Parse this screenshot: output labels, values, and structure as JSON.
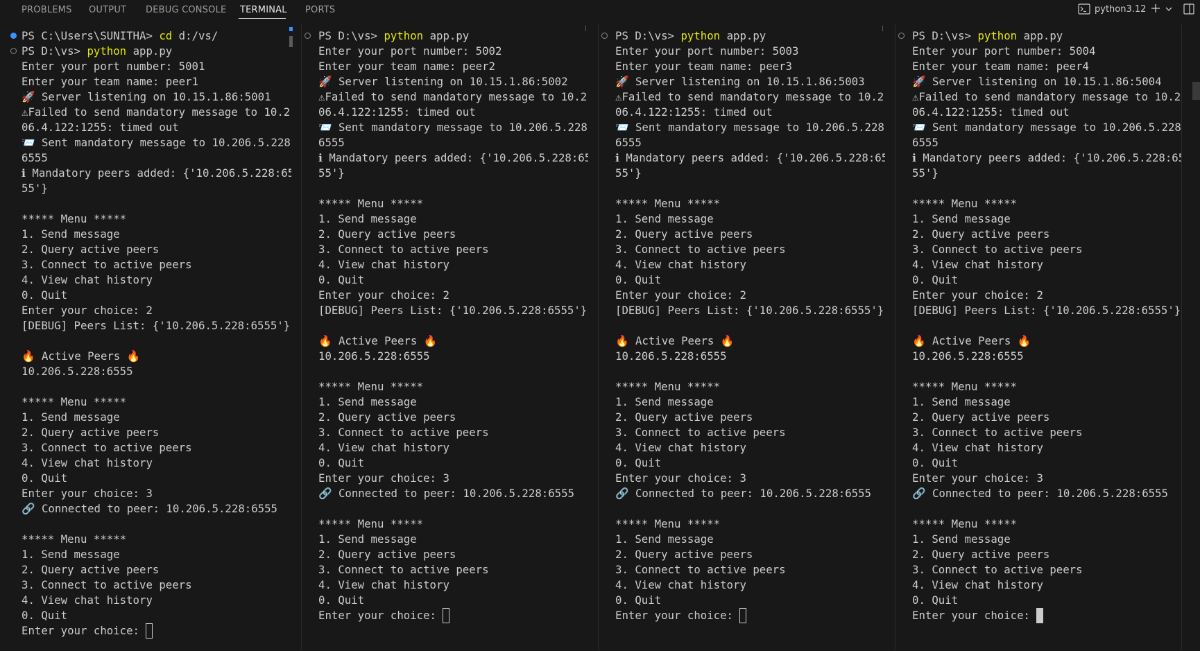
{
  "tabs": [
    {
      "label": "PROBLEMS",
      "active": false
    },
    {
      "label": "OUTPUT",
      "active": false
    },
    {
      "label": "DEBUG CONSOLE",
      "active": false
    },
    {
      "label": "TERMINAL",
      "active": true
    },
    {
      "label": "PORTS",
      "active": false
    }
  ],
  "toolbar": {
    "terminal_name": "python3.12",
    "icons": [
      "terminal-icon",
      "plus-icon",
      "chevron-down-icon",
      "split-layout-icon"
    ]
  },
  "colors": {
    "background": "#181818",
    "text": "#cccccc",
    "command": "#e5e510",
    "decoration_active": "#3794ff",
    "decoration_inactive": "#8a8a8a"
  },
  "terminals": [
    {
      "cursor": "hollow",
      "lines": [
        {
          "deco": "filled",
          "prompt": "PS C:\\Users\\SUNITHA> ",
          "cmd": "cd",
          "rest": " d:/vs/"
        },
        {
          "deco": "hollow",
          "prompt": "PS D:\\vs> ",
          "cmd": "python",
          "rest": " app.py"
        },
        {
          "text": "Enter your port number: 5001"
        },
        {
          "text": "Enter your team name: peer1"
        },
        {
          "text": "🚀 Server listening on 10.15.1.86:5001"
        },
        {
          "text": "⚠Failed to send mandatory message to 10.2"
        },
        {
          "text": "06.4.122:1255: timed out"
        },
        {
          "text": "📨 Sent mandatory message to 10.206.5.228:"
        },
        {
          "text": "6555"
        },
        {
          "text": "ℹ Mandatory peers added: {'10.206.5.228:65"
        },
        {
          "text": "55'}"
        },
        {
          "text": ""
        },
        {
          "text": "***** Menu *****"
        },
        {
          "text": "1. Send message"
        },
        {
          "text": "2. Query active peers"
        },
        {
          "text": "3. Connect to active peers"
        },
        {
          "text": "4. View chat history"
        },
        {
          "text": "0. Quit"
        },
        {
          "text": "Enter your choice: 2"
        },
        {
          "text": "[DEBUG] Peers List: {'10.206.5.228:6555'}"
        },
        {
          "text": ""
        },
        {
          "text": "🔥 Active Peers 🔥"
        },
        {
          "text": "10.206.5.228:6555"
        },
        {
          "text": ""
        },
        {
          "text": "***** Menu *****"
        },
        {
          "text": "1. Send message"
        },
        {
          "text": "2. Query active peers"
        },
        {
          "text": "3. Connect to active peers"
        },
        {
          "text": "4. View chat history"
        },
        {
          "text": "0. Quit"
        },
        {
          "text": "Enter your choice: 3"
        },
        {
          "text": "🔗 Connected to peer: 10.206.5.228:6555"
        },
        {
          "text": ""
        },
        {
          "text": "***** Menu *****"
        },
        {
          "text": "1. Send message"
        },
        {
          "text": "2. Query active peers"
        },
        {
          "text": "3. Connect to active peers"
        },
        {
          "text": "4. View chat history"
        },
        {
          "text": "0. Quit"
        },
        {
          "text": "Enter your choice: ",
          "cursor": true
        }
      ]
    },
    {
      "cursor": "hollow",
      "lines": [
        {
          "deco": "hollow",
          "prompt": "PS D:\\vs> ",
          "cmd": "python",
          "rest": " app.py"
        },
        {
          "text": "Enter your port number: 5002"
        },
        {
          "text": "Enter your team name: peer2"
        },
        {
          "text": "🚀 Server listening on 10.15.1.86:5002"
        },
        {
          "text": "⚠Failed to send mandatory message to 10.2"
        },
        {
          "text": "06.4.122:1255: timed out"
        },
        {
          "text": "📨 Sent mandatory message to 10.206.5.228:"
        },
        {
          "text": "6555"
        },
        {
          "text": "ℹ Mandatory peers added: {'10.206.5.228:65"
        },
        {
          "text": "55'}"
        },
        {
          "text": ""
        },
        {
          "text": "***** Menu *****"
        },
        {
          "text": "1. Send message"
        },
        {
          "text": "2. Query active peers"
        },
        {
          "text": "3. Connect to active peers"
        },
        {
          "text": "4. View chat history"
        },
        {
          "text": "0. Quit"
        },
        {
          "text": "Enter your choice: 2"
        },
        {
          "text": "[DEBUG] Peers List: {'10.206.5.228:6555'}"
        },
        {
          "text": ""
        },
        {
          "text": "🔥 Active Peers 🔥"
        },
        {
          "text": "10.206.5.228:6555"
        },
        {
          "text": ""
        },
        {
          "text": "***** Menu *****"
        },
        {
          "text": "1. Send message"
        },
        {
          "text": "2. Query active peers"
        },
        {
          "text": "3. Connect to active peers"
        },
        {
          "text": "4. View chat history"
        },
        {
          "text": "0. Quit"
        },
        {
          "text": "Enter your choice: 3"
        },
        {
          "text": "🔗 Connected to peer: 10.206.5.228:6555"
        },
        {
          "text": ""
        },
        {
          "text": "***** Menu *****"
        },
        {
          "text": "1. Send message"
        },
        {
          "text": "2. Query active peers"
        },
        {
          "text": "3. Connect to active peers"
        },
        {
          "text": "4. View chat history"
        },
        {
          "text": "0. Quit"
        },
        {
          "text": "Enter your choice: ",
          "cursor": true
        }
      ]
    },
    {
      "cursor": "hollow",
      "lines": [
        {
          "deco": "hollow",
          "prompt": "PS D:\\vs> ",
          "cmd": "python",
          "rest": " app.py"
        },
        {
          "text": "Enter your port number: 5003"
        },
        {
          "text": "Enter your team name: peer3"
        },
        {
          "text": "🚀 Server listening on 10.15.1.86:5003"
        },
        {
          "text": "⚠Failed to send mandatory message to 10.2"
        },
        {
          "text": "06.4.122:1255: timed out"
        },
        {
          "text": "📨 Sent mandatory message to 10.206.5.228:"
        },
        {
          "text": "6555"
        },
        {
          "text": "ℹ Mandatory peers added: {'10.206.5.228:65"
        },
        {
          "text": "55'}"
        },
        {
          "text": ""
        },
        {
          "text": "***** Menu *****"
        },
        {
          "text": "1. Send message"
        },
        {
          "text": "2. Query active peers"
        },
        {
          "text": "3. Connect to active peers"
        },
        {
          "text": "4. View chat history"
        },
        {
          "text": "0. Quit"
        },
        {
          "text": "Enter your choice: 2"
        },
        {
          "text": "[DEBUG] Peers List: {'10.206.5.228:6555'}"
        },
        {
          "text": ""
        },
        {
          "text": "🔥 Active Peers 🔥"
        },
        {
          "text": "10.206.5.228:6555"
        },
        {
          "text": ""
        },
        {
          "text": "***** Menu *****"
        },
        {
          "text": "1. Send message"
        },
        {
          "text": "2. Query active peers"
        },
        {
          "text": "3. Connect to active peers"
        },
        {
          "text": "4. View chat history"
        },
        {
          "text": "0. Quit"
        },
        {
          "text": "Enter your choice: 3"
        },
        {
          "text": "🔗 Connected to peer: 10.206.5.228:6555"
        },
        {
          "text": ""
        },
        {
          "text": "***** Menu *****"
        },
        {
          "text": "1. Send message"
        },
        {
          "text": "2. Query active peers"
        },
        {
          "text": "3. Connect to active peers"
        },
        {
          "text": "4. View chat history"
        },
        {
          "text": "0. Quit"
        },
        {
          "text": "Enter your choice: ",
          "cursor": true
        }
      ]
    },
    {
      "cursor": "solid",
      "lines": [
        {
          "deco": "hollow",
          "prompt": "PS D:\\vs> ",
          "cmd": "python",
          "rest": " app.py"
        },
        {
          "text": "Enter your port number: 5004"
        },
        {
          "text": "Enter your team name: peer4"
        },
        {
          "text": "🚀 Server listening on 10.15.1.86:5004"
        },
        {
          "text": "⚠Failed to send mandatory message to 10.2"
        },
        {
          "text": "06.4.122:1255: timed out"
        },
        {
          "text": "📨 Sent mandatory message to 10.206.5.228:"
        },
        {
          "text": "6555"
        },
        {
          "text": "ℹ Mandatory peers added: {'10.206.5.228:65"
        },
        {
          "text": "55'}"
        },
        {
          "text": ""
        },
        {
          "text": "***** Menu *****"
        },
        {
          "text": "1. Send message"
        },
        {
          "text": "2. Query active peers"
        },
        {
          "text": "3. Connect to active peers"
        },
        {
          "text": "4. View chat history"
        },
        {
          "text": "0. Quit"
        },
        {
          "text": "Enter your choice: 2"
        },
        {
          "text": "[DEBUG] Peers List: {'10.206.5.228:6555'}"
        },
        {
          "text": ""
        },
        {
          "text": "🔥 Active Peers 🔥"
        },
        {
          "text": "10.206.5.228:6555"
        },
        {
          "text": ""
        },
        {
          "text": "***** Menu *****"
        },
        {
          "text": "1. Send message"
        },
        {
          "text": "2. Query active peers"
        },
        {
          "text": "3. Connect to active peers"
        },
        {
          "text": "4. View chat history"
        },
        {
          "text": "0. Quit"
        },
        {
          "text": "Enter your choice: 3"
        },
        {
          "text": "🔗 Connected to peer: 10.206.5.228:6555"
        },
        {
          "text": ""
        },
        {
          "text": "***** Menu *****"
        },
        {
          "text": "1. Send message"
        },
        {
          "text": "2. Query active peers"
        },
        {
          "text": "3. Connect to active peers"
        },
        {
          "text": "4. View chat history"
        },
        {
          "text": "0. Quit"
        },
        {
          "text": "Enter your choice: ",
          "cursor": true
        }
      ]
    }
  ]
}
